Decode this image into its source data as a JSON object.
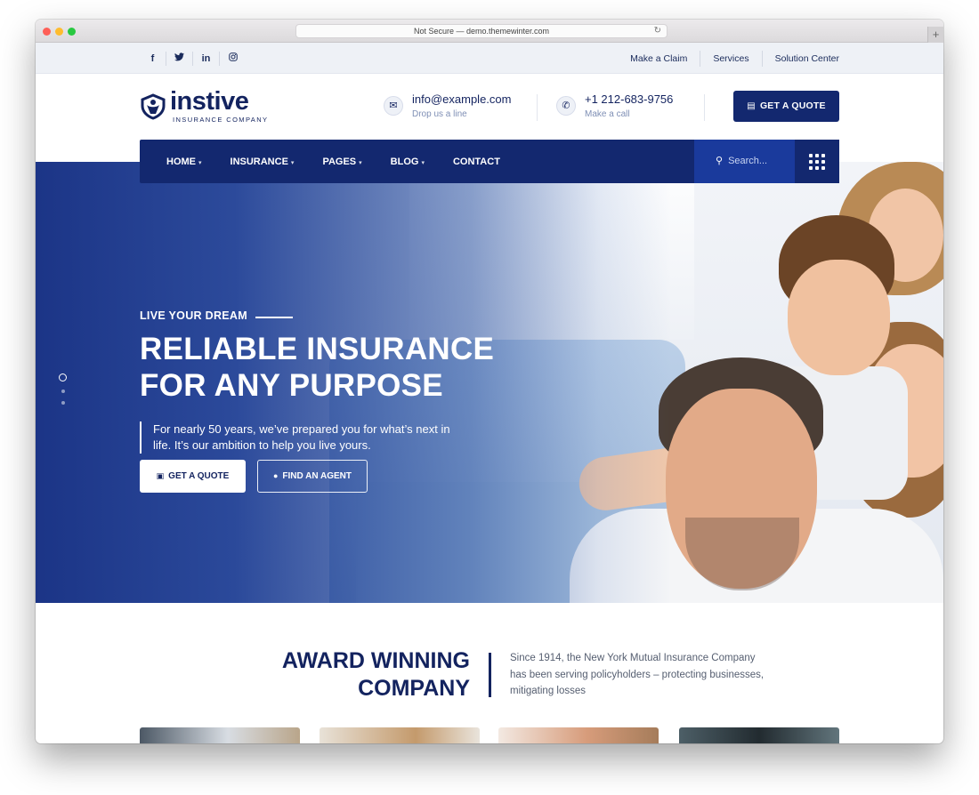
{
  "browser": {
    "url": "Not Secure — demo.themewinter.com",
    "reload_icon": "reload-icon",
    "new_tab_icon": "plus-icon"
  },
  "topbar": {
    "social": [
      {
        "name": "facebook-icon",
        "glyph": "f"
      },
      {
        "name": "twitter-icon",
        "glyph": "t"
      },
      {
        "name": "linkedin-icon",
        "glyph": "in"
      },
      {
        "name": "instagram-icon",
        "glyph": "◎"
      }
    ],
    "links": [
      "Make a Claim",
      "Services",
      "Solution Center"
    ]
  },
  "header": {
    "logo_name": "instive",
    "logo_tag": "INSURANCE COMPANY",
    "email": {
      "value": "info@example.com",
      "sub": "Drop us a line",
      "icon": "envelope-icon"
    },
    "phone": {
      "value": "+1 212-683-9756",
      "sub": "Make a call",
      "icon": "phone-icon"
    },
    "quote_button": "GET A QUOTE"
  },
  "nav": {
    "items": [
      {
        "label": "HOME",
        "dropdown": true
      },
      {
        "label": "INSURANCE",
        "dropdown": true
      },
      {
        "label": "PAGES",
        "dropdown": true
      },
      {
        "label": "BLOG",
        "dropdown": true
      },
      {
        "label": "CONTACT",
        "dropdown": false
      }
    ],
    "search_placeholder": "Search...",
    "chevron": "⌄",
    "grid_icon": "grid-icon"
  },
  "hero": {
    "eyebrow": "LIVE YOUR DREAM",
    "headline_line1": "RELIABLE INSURANCE",
    "headline_line2": "FOR ANY PURPOSE",
    "description": "For nearly 50 years, we’ve prepared you for what’s next in life. It’s our ambition to help you live yours.",
    "primary_button": "GET A QUOTE",
    "secondary_button": "FIND AN AGENT",
    "slider_dots": 3,
    "active_slide": 1
  },
  "about": {
    "title_line1": "AWARD WINNING",
    "title_line2": "COMPANY",
    "text": "Since 1914, the New York Mutual Insurance Company has been serving policyholders – protecting businesses, mitigating losses"
  },
  "colors": {
    "brand": "#13286f",
    "brand_dark": "#13235f",
    "topbar_bg": "#eef1f6",
    "search_bg": "#1a3a9c"
  }
}
